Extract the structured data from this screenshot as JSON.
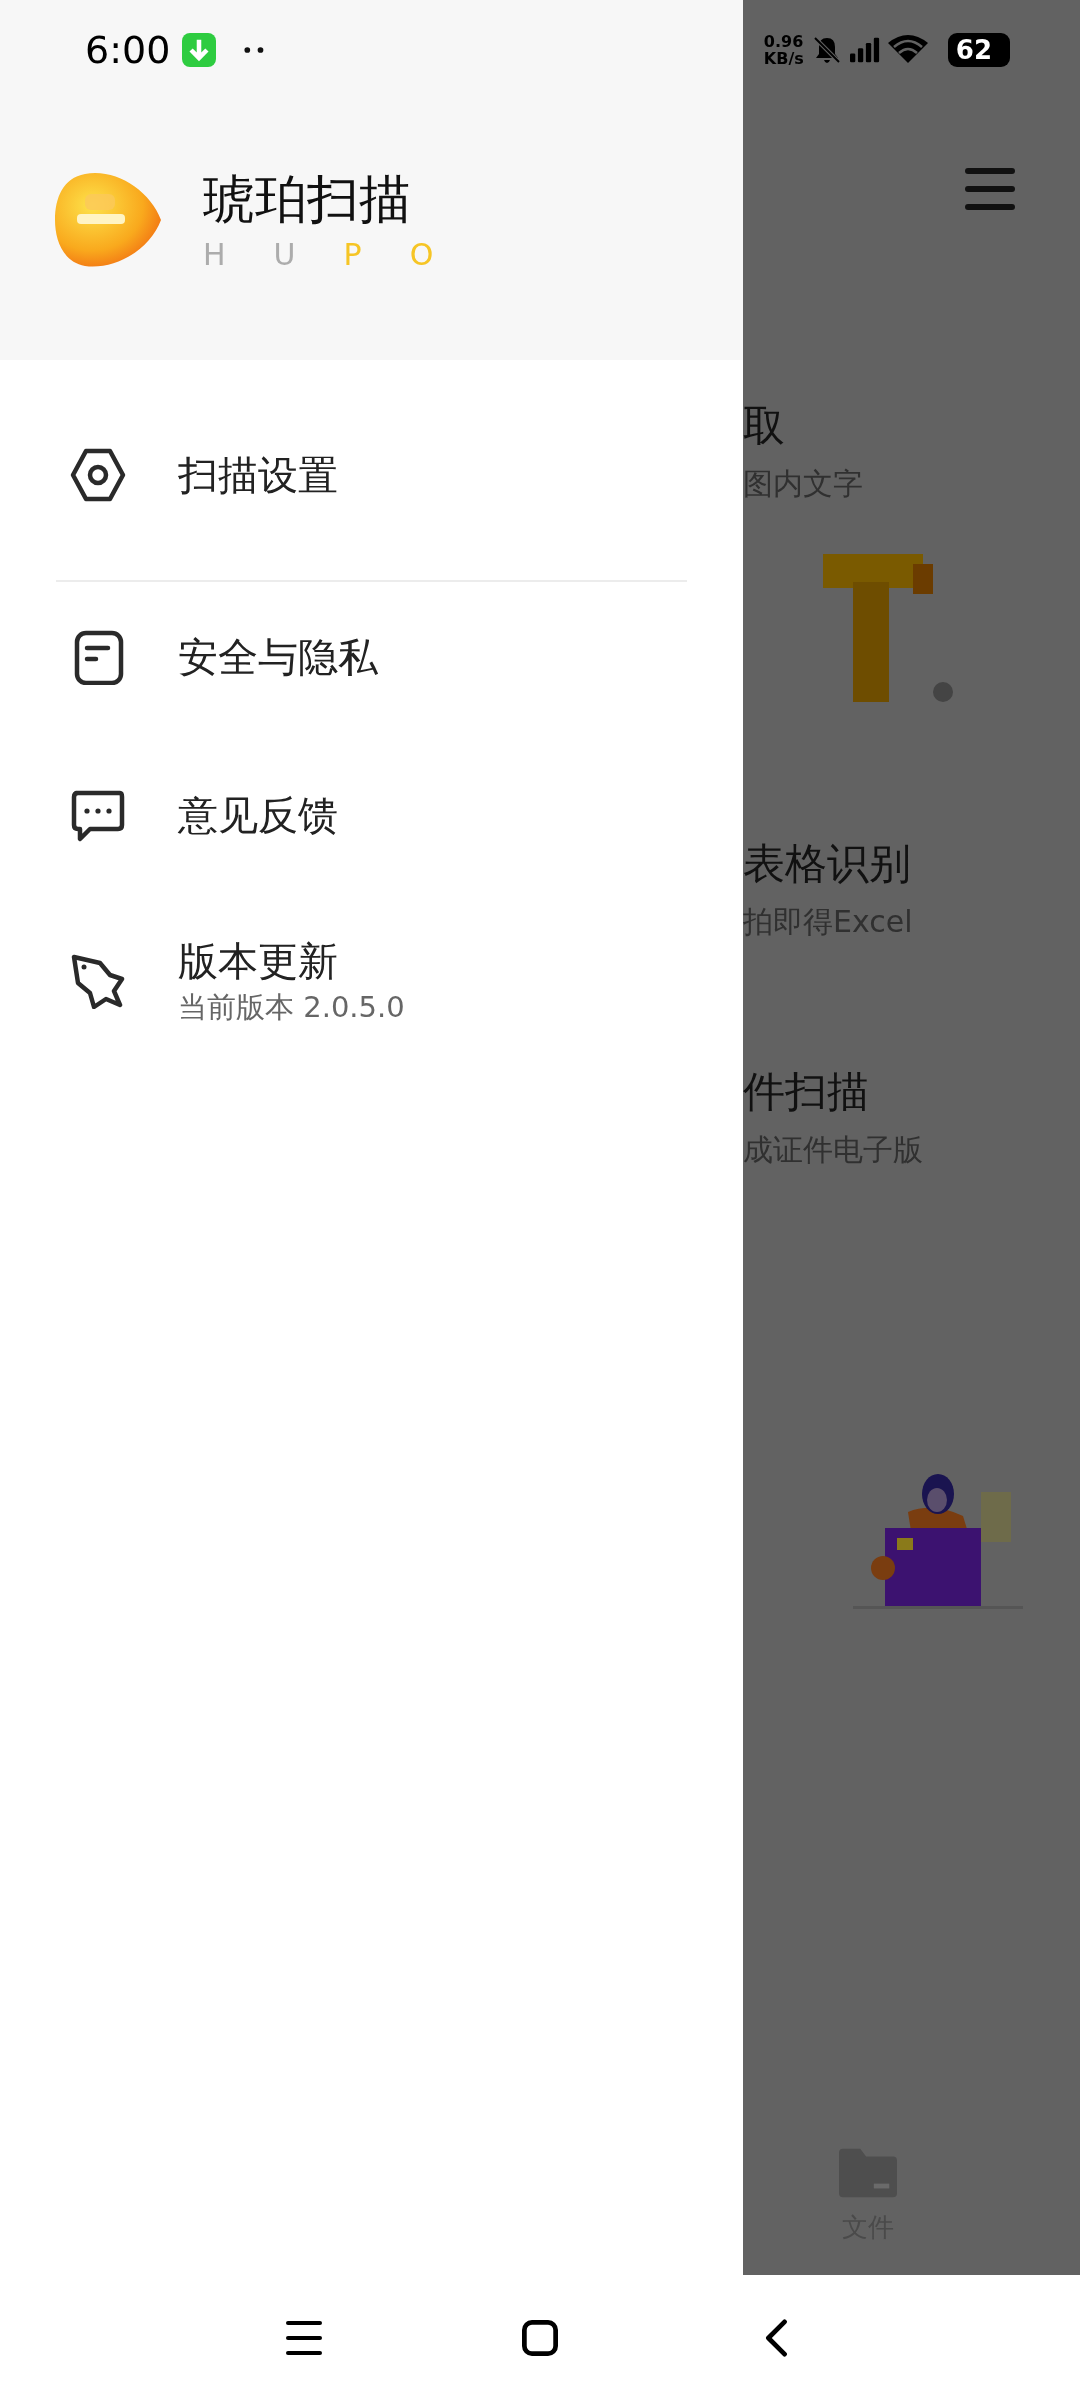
{
  "status_bar": {
    "time": "6:00",
    "speed_value": "0.96",
    "speed_unit": "KB/s",
    "battery": "62"
  },
  "drawer": {
    "app_name": "琥珀扫描",
    "subtitle_letters": [
      {
        "text": "H",
        "color": "#acacac"
      },
      {
        "text": "U",
        "color": "#acacac"
      },
      {
        "text": "P",
        "color": "#f6c525"
      },
      {
        "text": "O",
        "color": "#f6c525"
      }
    ],
    "menu": [
      {
        "kind": "settings",
        "label": "扫描设置",
        "divider_after": true
      },
      {
        "kind": "privacy",
        "label": "安全与隐私",
        "divider_after": false
      },
      {
        "kind": "feedback",
        "label": "意见反馈",
        "divider_after": false
      },
      {
        "kind": "update",
        "label": "版本更新",
        "subtitle": "当前版本 2.0.5.0",
        "divider_after": false
      }
    ]
  },
  "background": {
    "features": [
      {
        "kind": "text",
        "title": "取",
        "subtitle": "图内文字"
      },
      {
        "kind": "table",
        "title": "表格识别",
        "subtitle": "拍即得Excel"
      },
      {
        "kind": "id",
        "title": "件扫描",
        "subtitle": "成证件电子版"
      }
    ],
    "tab_label": "文件"
  }
}
